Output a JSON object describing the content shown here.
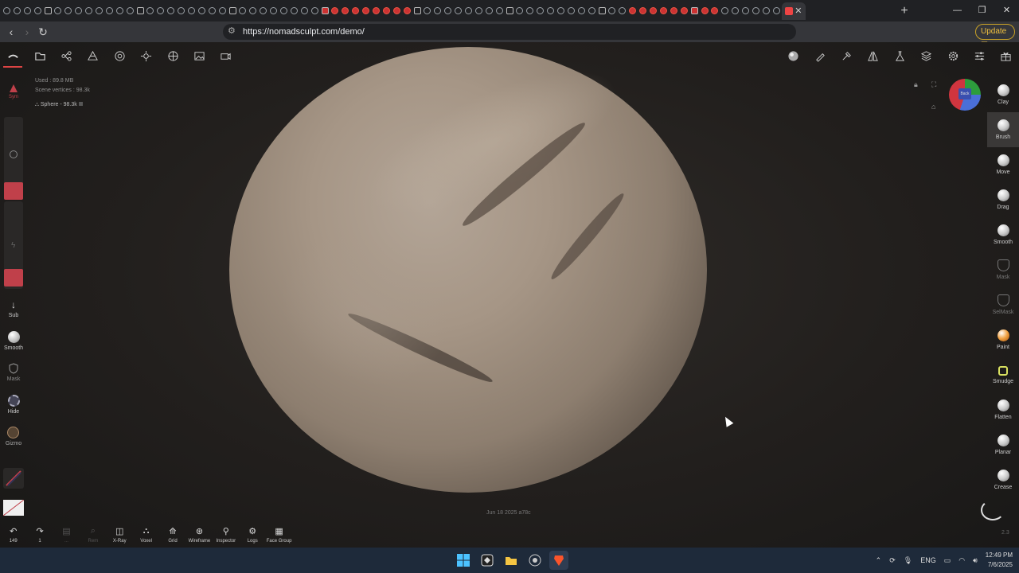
{
  "browser": {
    "url": "https://nomadsculpt.com/demo/",
    "update_label": "Update",
    "tab_count": 76
  },
  "stats": {
    "used": "Used : 89.8 MB",
    "scene_vertices": "Scene vertices : 98.3k",
    "mesh": "Sphere - 98.3k"
  },
  "left_tools": {
    "sym": "Sym",
    "sub": "Sub",
    "smooth": "Smooth",
    "mask": "Mask",
    "hide": "Hide",
    "gizmo": "Gizmo"
  },
  "right_tools": [
    {
      "label": "Clay",
      "icon": "clay-ball-icon",
      "selected": false,
      "dim": false
    },
    {
      "label": "Brush",
      "icon": "brush-ball-icon",
      "selected": true,
      "dim": false
    },
    {
      "label": "Move",
      "icon": "move-ball-icon",
      "selected": false,
      "dim": false
    },
    {
      "label": "Drag",
      "icon": "drag-ball-icon",
      "selected": false,
      "dim": false
    },
    {
      "label": "Smooth",
      "icon": "smooth-ball-icon",
      "selected": false,
      "dim": false
    },
    {
      "label": "Mask",
      "icon": "mask-shield-icon",
      "selected": false,
      "dim": true
    },
    {
      "label": "SelMask",
      "icon": "selmask-shield-icon",
      "selected": false,
      "dim": true
    },
    {
      "label": "Paint",
      "icon": "paint-ball-icon",
      "selected": false,
      "dim": false
    },
    {
      "label": "Smudge",
      "icon": "smudge-icon",
      "selected": false,
      "dim": false
    },
    {
      "label": "Flatten",
      "icon": "flatten-ball-icon",
      "selected": false,
      "dim": false
    },
    {
      "label": "Planar",
      "icon": "planar-ball-icon",
      "selected": false,
      "dim": false
    },
    {
      "label": "Crease",
      "icon": "crease-ball-icon",
      "selected": false,
      "dim": false
    }
  ],
  "bottom_tools": [
    {
      "sym": "↶",
      "label": "149",
      "dim": false,
      "name": "undo-button"
    },
    {
      "sym": "↷",
      "label": "1",
      "dim": false,
      "name": "redo-button"
    },
    {
      "sym": "▤",
      "label": "...",
      "dim": true,
      "name": "history-button"
    },
    {
      "sym": "⌕",
      "label": "Rem",
      "dim": true,
      "name": "remesh-button"
    },
    {
      "sym": "◫",
      "label": "X-Ray",
      "dim": false,
      "name": "xray-button"
    },
    {
      "sym": "⛬",
      "label": "Voxel",
      "dim": false,
      "name": "voxel-button"
    },
    {
      "sym": "⟰",
      "label": "Grid",
      "dim": false,
      "name": "grid-button"
    },
    {
      "sym": "⊛",
      "label": "Wireframe",
      "dim": false,
      "name": "wireframe-button"
    },
    {
      "sym": "⚲",
      "label": "Inspector",
      "dim": false,
      "name": "inspector-button"
    },
    {
      "sym": "⚙",
      "label": "Logs",
      "dim": false,
      "name": "logs-button"
    },
    {
      "sym": "▦",
      "label": "Face Group",
      "dim": false,
      "name": "face-group-button"
    }
  ],
  "gizmo_face": "Back",
  "datestamp": "Jun 18 2025 a78c",
  "version": "2.3",
  "taskbar": {
    "lang": "ENG",
    "time": "12:49 PM",
    "date": "7/6/2025"
  },
  "colors": {
    "accent_red": "#c0404a",
    "update_gold": "#c9a227",
    "viewport_bg": "#221f1d"
  }
}
